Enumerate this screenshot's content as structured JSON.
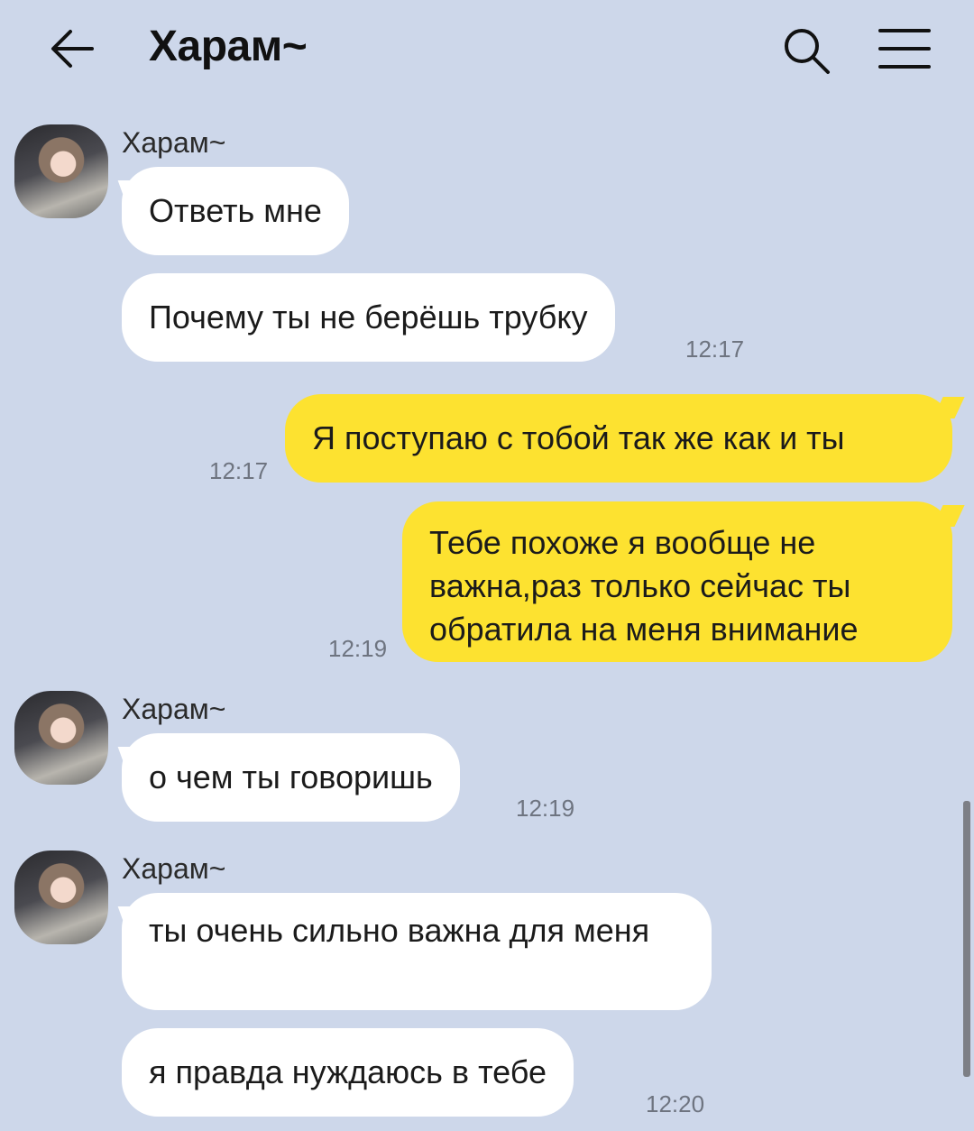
{
  "header": {
    "title": "Харам~"
  },
  "messages": [
    {
      "sender": "Харам~",
      "text": "Ответь мне"
    },
    {
      "text": "Почему ты не берёшь трубку",
      "time": "12:17"
    },
    {
      "text": "Я поступаю с тобой так же как и ты",
      "time": "12:17"
    },
    {
      "text": "Тебе похоже я вообще не важна,раз только сейчас ты обратила на меня внимание",
      "time": "12:19"
    },
    {
      "sender": "Харам~",
      "text": "о чем ты говоришь",
      "time": "12:19"
    },
    {
      "sender": "Харам~",
      "text": "ты очень сильно важна для меня"
    },
    {
      "text": "я правда нуждаюсь в тебе",
      "time": "12:20"
    }
  ],
  "colors": {
    "background": "#cdd7ea",
    "incoming_bubble": "#ffffff",
    "outgoing_bubble": "#fde230"
  },
  "icons": [
    "back-arrow-icon",
    "search-icon",
    "menu-icon"
  ]
}
